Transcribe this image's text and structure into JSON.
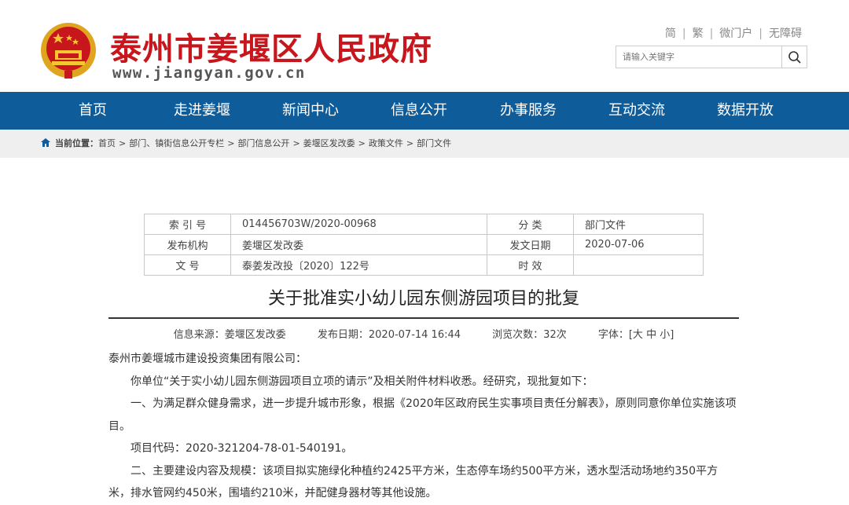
{
  "header": {
    "site_title": "泰州市姜堰区人民政府",
    "site_domain": "www.jiangyan.gov.cn",
    "links": [
      "简",
      "繁",
      "微门户",
      "无障碍"
    ],
    "search_placeholder": "请输入关键字"
  },
  "nav": [
    "首页",
    "走进姜堰",
    "新闻中心",
    "信息公开",
    "办事服务",
    "互动交流",
    "数据开放"
  ],
  "breadcrumb": {
    "label": "当前位置：",
    "items": [
      "首页",
      "部门、镇街信息公开专栏",
      "部门信息公开",
      "姜堰区发改委",
      "政策文件",
      "部门文件"
    ]
  },
  "meta": {
    "index_label": "索 引 号",
    "index_value": "014456703W/2020-00968",
    "category_label": "分 类",
    "category_value": "部门文件",
    "publisher_label": "发布机构",
    "publisher_value": "姜堰区发改委",
    "date_label": "发文日期",
    "date_value": "2020-07-06",
    "docno_label": "文 号",
    "docno_value": "泰姜发改投〔2020〕122号",
    "validity_label": "时 效",
    "validity_value": ""
  },
  "article": {
    "title": "关于批准实小幼儿园东侧游园项目的批复",
    "source": "信息来源：姜堰区发改委",
    "publish_date": "发布日期：2020-07-14 16:44",
    "views": "浏览次数：32次",
    "font_size": "字体：[大 中 小]",
    "paragraphs": [
      "泰州市姜堰城市建设投资集团有限公司：",
      "你单位“关于实小幼儿园东侧游园项目立项的请示”及相关附件材料收悉。经研究，现批复如下：",
      "一、为满足群众健身需求，进一步提升城市形象，根据《2020年区政府民生实事项目责任分解表》，原则同意你单位实施该项目。",
      "项目代码：2020-321204-78-01-540191。",
      "二、主要建设内容及规模：该项目拟实施绿化种植约2425平方米，生态停车场约500平方米，透水型活动场地约350平方米，排水管网约450米，围墙约210米，并配健身器材等其他设施。"
    ]
  },
  "colors": {
    "brand_red": "#c8161d",
    "nav_blue": "#0f5c9b"
  },
  "icons": {
    "emblem": "national-emblem-icon",
    "search": "search-icon",
    "home": "home-icon"
  }
}
